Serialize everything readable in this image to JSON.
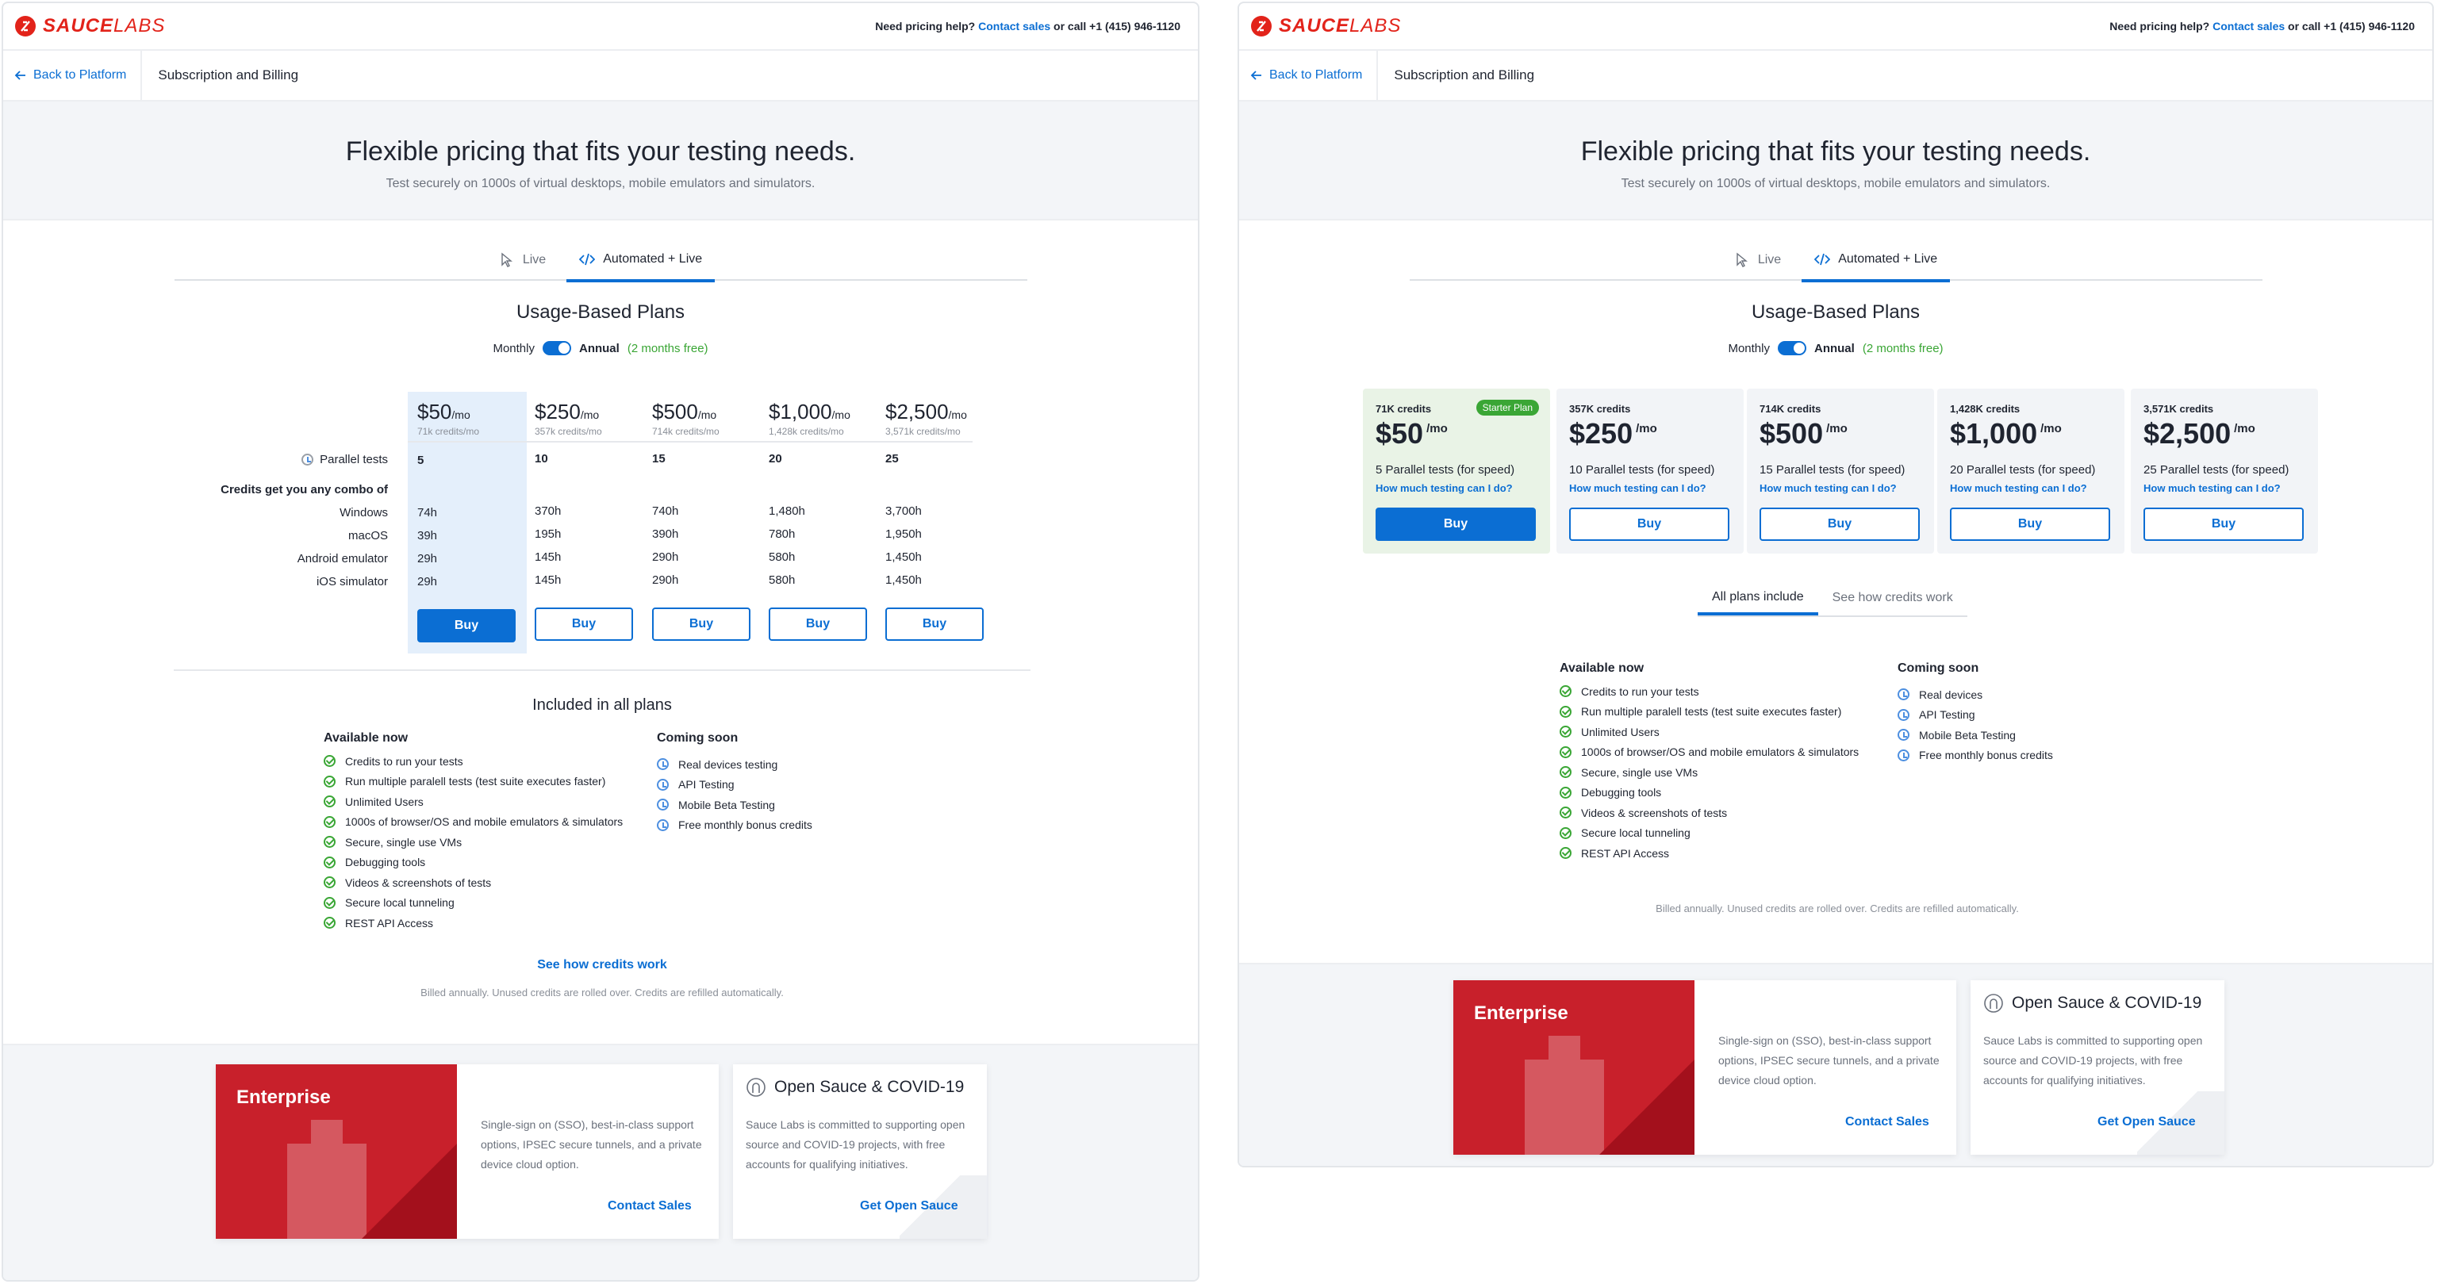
{
  "brand": {
    "logo_text_bold": "SAUCE",
    "logo_text_light": "LABS"
  },
  "help": {
    "prefix": "Need pricing help?",
    "link": "Contact sales",
    "suffix": "or call +1 (415) 946-1120"
  },
  "nav": {
    "back": "Back to Platform",
    "crumb": "Subscription and Billing"
  },
  "hero": {
    "title": "Flexible pricing that fits your testing needs.",
    "subtitle": "Test securely on 1000s of virtual desktops, mobile emulators and simulators."
  },
  "tabs": [
    {
      "label": "Live"
    },
    {
      "label": "Automated + Live",
      "active": true
    }
  ],
  "plans_title": "Usage-Based Plans",
  "billing_toggle": {
    "monthly": "Monthly",
    "annual": "Annual",
    "promo": "(2 months free)"
  },
  "panel1": {
    "plans": [
      {
        "price": "$50",
        "per": "/mo",
        "credits": "71k credits/mo",
        "parallel": "5",
        "windows": "74h",
        "macos": "39h",
        "android": "29h",
        "ios": "29h"
      },
      {
        "price": "$250",
        "per": "/mo",
        "credits": "357k credits/mo",
        "parallel": "10",
        "windows": "370h",
        "macos": "195h",
        "android": "145h",
        "ios": "145h"
      },
      {
        "price": "$500",
        "per": "/mo",
        "credits": "714k credits/mo",
        "parallel": "15",
        "windows": "740h",
        "macos": "390h",
        "android": "290h",
        "ios": "290h"
      },
      {
        "price": "$1,000",
        "per": "/mo",
        "credits": "1,428k credits/mo",
        "parallel": "20",
        "windows": "1,480h",
        "macos": "780h",
        "android": "580h",
        "ios": "580h"
      },
      {
        "price": "$2,500",
        "per": "/mo",
        "credits": "3,571k credits/mo",
        "parallel": "25",
        "windows": "3,700h",
        "macos": "1,950h",
        "android": "1,450h",
        "ios": "1,450h"
      }
    ],
    "row_labels": {
      "parallel": "Parallel tests",
      "combo": "Credits get you any combo of",
      "windows": "Windows",
      "macos": "macOS",
      "android": "Android emulator",
      "ios": "iOS simulator"
    },
    "buy_label": "Buy",
    "included_title": "Included in all plans",
    "see_credits": "See how credits work"
  },
  "available": {
    "title": "Available now",
    "items": [
      "Credits to run your tests",
      "Run multiple paralell tests (test suite executes faster)",
      "Unlimited Users",
      "1000s of browser/OS and mobile emulators & simulators",
      "Secure, single use VMs",
      "Debugging tools",
      "Videos & screenshots of tests",
      "Secure local tunneling",
      "REST API Access"
    ]
  },
  "coming": {
    "title": "Coming soon",
    "items_p1": [
      "Real devices testing",
      "API Testing",
      "Mobile Beta Testing",
      "Free monthly bonus credits"
    ],
    "items_p2": [
      "Real devices",
      "API Testing",
      "Mobile Beta Testing",
      "Free monthly bonus credits"
    ]
  },
  "billing_note": "Billed annually. Unused credits are rolled over. Credits are refilled automatically.",
  "enterprise": {
    "title": "Enterprise",
    "text": "Single-sign on (SSO), best-in-class support options, IPSEC secure tunnels, and a private device cloud option.",
    "link": "Contact Sales"
  },
  "opensauce": {
    "title": "Open Sauce & COVID-19",
    "text": "Sauce Labs is committed to supporting open source and COVID-19 projects, with free accounts for qualifying initiatives.",
    "link": "Get Open Sauce"
  },
  "panel2": {
    "cards": [
      {
        "credits": "71K credits",
        "badge": "Starter Plan",
        "price": "$50",
        "per": "/mo",
        "parallel": "5 Parallel tests (for speed)",
        "how": "How much testing can I do?",
        "buy": "Buy"
      },
      {
        "credits": "357K credits",
        "price": "$250",
        "per": "/mo",
        "parallel": "10 Parallel tests (for speed)",
        "how": "How much testing can I do?",
        "buy": "Buy"
      },
      {
        "credits": "714K credits",
        "price": "$500",
        "per": "/mo",
        "parallel": "15 Parallel tests (for speed)",
        "how": "How much testing can I do?",
        "buy": "Buy"
      },
      {
        "credits": "1,428K credits",
        "price": "$1,000",
        "per": "/mo",
        "parallel": "20 Parallel tests (for speed)",
        "how": "How much testing can I do?",
        "buy": "Buy"
      },
      {
        "credits": "3,571K credits",
        "price": "$2,500",
        "per": "/mo",
        "parallel": "25 Parallel tests (for speed)",
        "how": "How much testing can I do?",
        "buy": "Buy"
      }
    ],
    "subtabs": [
      "All plans include",
      "See how credits work"
    ]
  },
  "colors": {
    "accent": "#0b6ed3",
    "brand_red": "#e2231a",
    "green": "#3aa635",
    "enterprise_red": "#c8202b"
  }
}
